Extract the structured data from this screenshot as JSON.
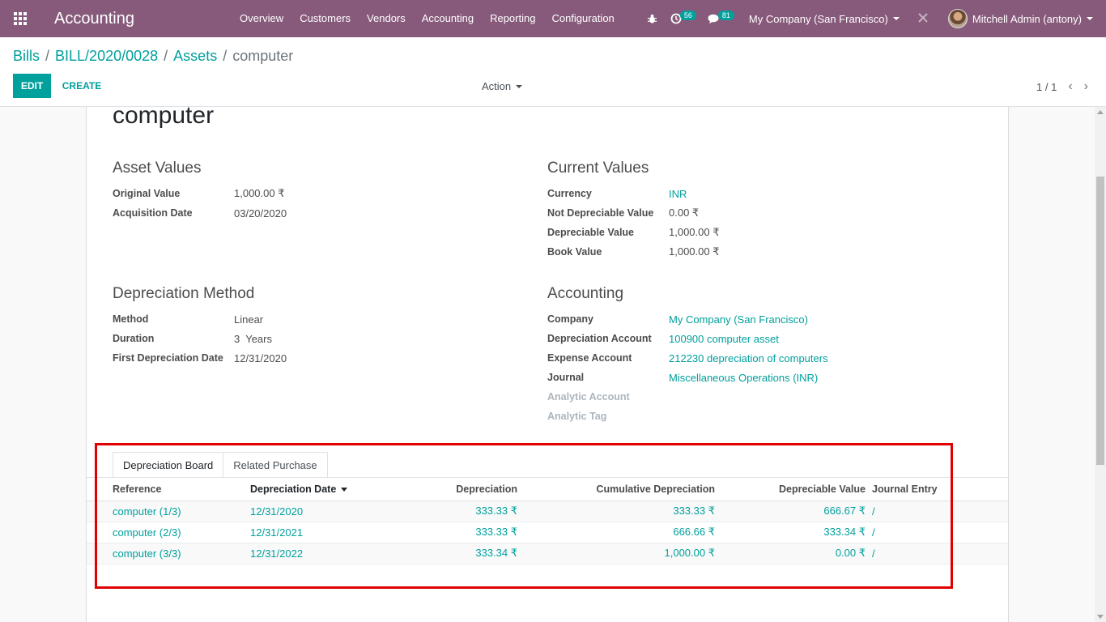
{
  "navbar": {
    "app_title": "Accounting",
    "menu": [
      "Overview",
      "Customers",
      "Vendors",
      "Accounting",
      "Reporting",
      "Configuration"
    ],
    "activity_count": "56",
    "message_count": "81",
    "company": "My Company (San Francisco)",
    "user": "Mitchell Admin (antony)",
    "brand_color": "#875A7B",
    "accent_color": "#00A09D"
  },
  "breadcrumb": {
    "items": [
      "Bills",
      "BILL/2020/0028",
      "Assets"
    ],
    "current": "computer",
    "separator": "/"
  },
  "toolbar": {
    "edit_label": "EDIT",
    "create_label": "CREATE",
    "action_label": "Action",
    "pager": "1 / 1"
  },
  "record": {
    "title": "computer"
  },
  "asset_values": {
    "heading": "Asset Values",
    "fields": [
      {
        "label": "Original Value",
        "value": "1,000.00 ₹"
      },
      {
        "label": "Acquisition Date",
        "value": "03/20/2020"
      }
    ]
  },
  "current_values": {
    "heading": "Current Values",
    "fields": [
      {
        "label": "Currency",
        "value": "INR"
      },
      {
        "label": "Not Depreciable Value",
        "value": "0.00 ₹"
      },
      {
        "label": "Depreciable Value",
        "value": "1,000.00 ₹"
      },
      {
        "label": "Book Value",
        "value": "1,000.00 ₹"
      }
    ]
  },
  "depreciation_method": {
    "heading": "Depreciation Method",
    "fields": [
      {
        "label": "Method",
        "value": "Linear"
      },
      {
        "label": "Duration",
        "value": "3  Years"
      },
      {
        "label": "First Depreciation Date",
        "value": "12/31/2020"
      }
    ]
  },
  "accounting": {
    "heading": "Accounting",
    "fields": [
      {
        "label": "Company",
        "value": "My Company (San Francisco)"
      },
      {
        "label": "Depreciation Account",
        "value": "100900 computer asset"
      },
      {
        "label": "Expense Account",
        "value": "212230 depreciation of computers"
      },
      {
        "label": "Journal",
        "value": "Miscellaneous Operations (INR)"
      },
      {
        "label": "Analytic Account",
        "value": ""
      },
      {
        "label": "Analytic Tag",
        "value": ""
      }
    ]
  },
  "tabs": [
    "Depreciation Board",
    "Related Purchase"
  ],
  "board": {
    "columns": [
      "Reference",
      "Depreciation Date",
      "Depreciation",
      "Cumulative Depreciation",
      "Depreciable Value",
      "Journal Entry"
    ],
    "rows": [
      [
        "computer (1/3)",
        "12/31/2020",
        "333.33 ₹",
        "333.33 ₹",
        "666.67 ₹",
        "/"
      ],
      [
        "computer (2/3)",
        "12/31/2021",
        "333.33 ₹",
        "666.66 ₹",
        "333.34 ₹",
        "/"
      ],
      [
        "computer (3/3)",
        "12/31/2022",
        "333.34 ₹",
        "1,000.00 ₹",
        "0.00 ₹",
        "/"
      ]
    ]
  }
}
